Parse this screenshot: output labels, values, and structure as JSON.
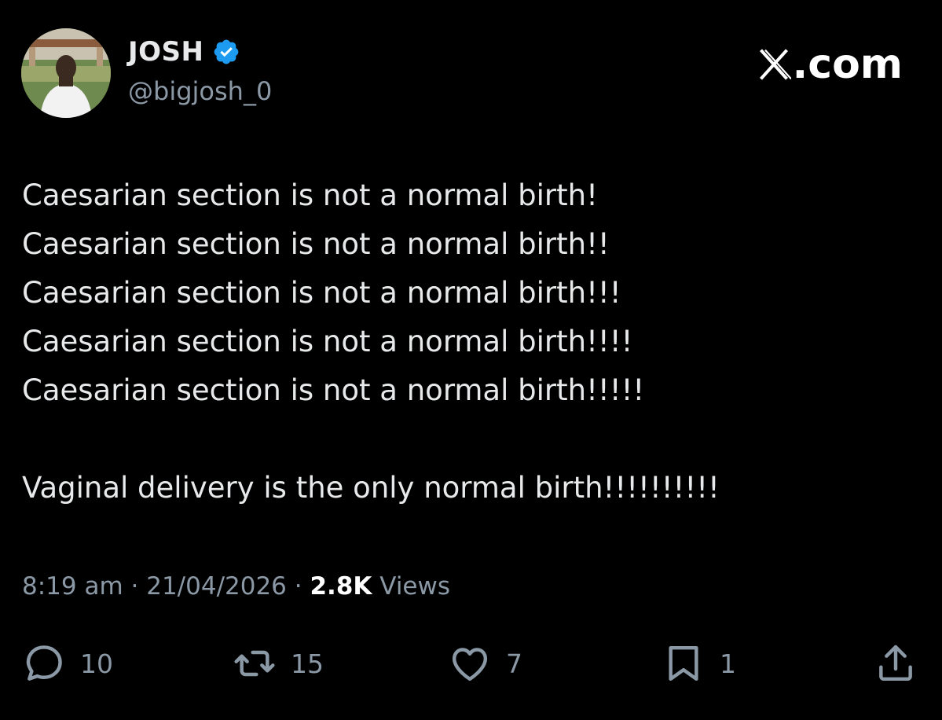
{
  "author": {
    "display_name": "JOSH",
    "handle": "@bigjosh_0",
    "verified": true,
    "avatar_icon": "profile-photo"
  },
  "brand": {
    "text": ".com",
    "logo_icon": "x-logo"
  },
  "tweet": {
    "lines": [
      "Caesarian section is not a normal birth!",
      "Caesarian section is not a normal birth!!",
      "Caesarian section is not a normal birth!!!",
      "Caesarian section is not a normal birth!!!!",
      "Caesarian section is not a normal birth!!!!!",
      "",
      "Vaginal delivery is the only normal birth!!!!!!!!!!"
    ]
  },
  "meta": {
    "time": "8:19 am",
    "separator": " · ",
    "date": "21/04/2026",
    "views_count": "2.8K",
    "views_label": " Views"
  },
  "actions": {
    "replies": {
      "icon": "reply-icon",
      "count": "10"
    },
    "reposts": {
      "icon": "repost-icon",
      "count": "15"
    },
    "likes": {
      "icon": "heart-icon",
      "count": "7"
    },
    "bookmarks": {
      "icon": "bookmark-icon",
      "count": "1"
    },
    "share": {
      "icon": "share-icon"
    }
  },
  "colors": {
    "background": "#000000",
    "text": "#e7e9ea",
    "secondary_text": "#8b98a5",
    "verified_badge": "#1d9bf0"
  }
}
